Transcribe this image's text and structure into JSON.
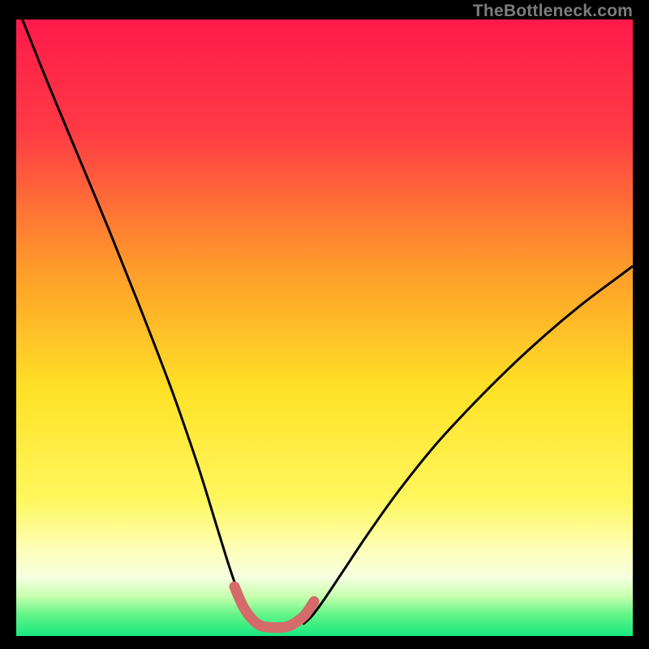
{
  "watermark": "TheBottleneck.com",
  "chart_data": {
    "type": "line",
    "title": "",
    "xlabel": "",
    "ylabel": "",
    "xlim": [
      0,
      100
    ],
    "ylim": [
      0,
      100
    ],
    "grid": false,
    "legend": false,
    "gradient_stops": [
      {
        "pos": 0.0,
        "color": "#ff1a4b"
      },
      {
        "pos": 0.18,
        "color": "#ff3a45"
      },
      {
        "pos": 0.4,
        "color": "#ff9a2a"
      },
      {
        "pos": 0.6,
        "color": "#ffe126"
      },
      {
        "pos": 0.78,
        "color": "#fff75e"
      },
      {
        "pos": 0.86,
        "color": "#fdffb8"
      },
      {
        "pos": 0.905,
        "color": "#f5ffe0"
      },
      {
        "pos": 0.935,
        "color": "#c9ffb0"
      },
      {
        "pos": 0.965,
        "color": "#63f587"
      },
      {
        "pos": 1.0,
        "color": "#18e880"
      }
    ],
    "series": [
      {
        "name": "left-curve",
        "color": "#000000",
        "width": 3,
        "x": [
          1.0,
          5,
          10,
          15,
          20,
          25,
          28,
          30,
          32,
          34,
          35.5,
          37,
          38.2,
          39.5
        ],
        "y": [
          100,
          90,
          78,
          66,
          53.5,
          40.5,
          32,
          26,
          19.5,
          13,
          8.5,
          5.0,
          3.0,
          1.9
        ]
      },
      {
        "name": "right-curve",
        "color": "#000000",
        "width": 3,
        "x": [
          46.5,
          48,
          50,
          53,
          57,
          62,
          68,
          74,
          80,
          86,
          92,
          98,
          100
        ],
        "y": [
          1.9,
          3.3,
          6.0,
          10.5,
          16.5,
          23.5,
          31,
          37.5,
          43.5,
          49,
          54,
          58.5,
          60
        ]
      },
      {
        "name": "dip-highlight",
        "color": "#d46a6a",
        "width": 13,
        "linecap": "round",
        "x": [
          35.4,
          36.8,
          38.2,
          39.6,
          41.2,
          43.2,
          44.2,
          45.3,
          46.8,
          48.3
        ],
        "y": [
          8.0,
          4.8,
          2.8,
          1.7,
          1.4,
          1.4,
          1.6,
          2.2,
          3.4,
          5.6
        ]
      }
    ],
    "notes": "V-shaped bottleneck chart over a vertical red→orange→yellow→white→green gradient; values estimated from pixels."
  }
}
